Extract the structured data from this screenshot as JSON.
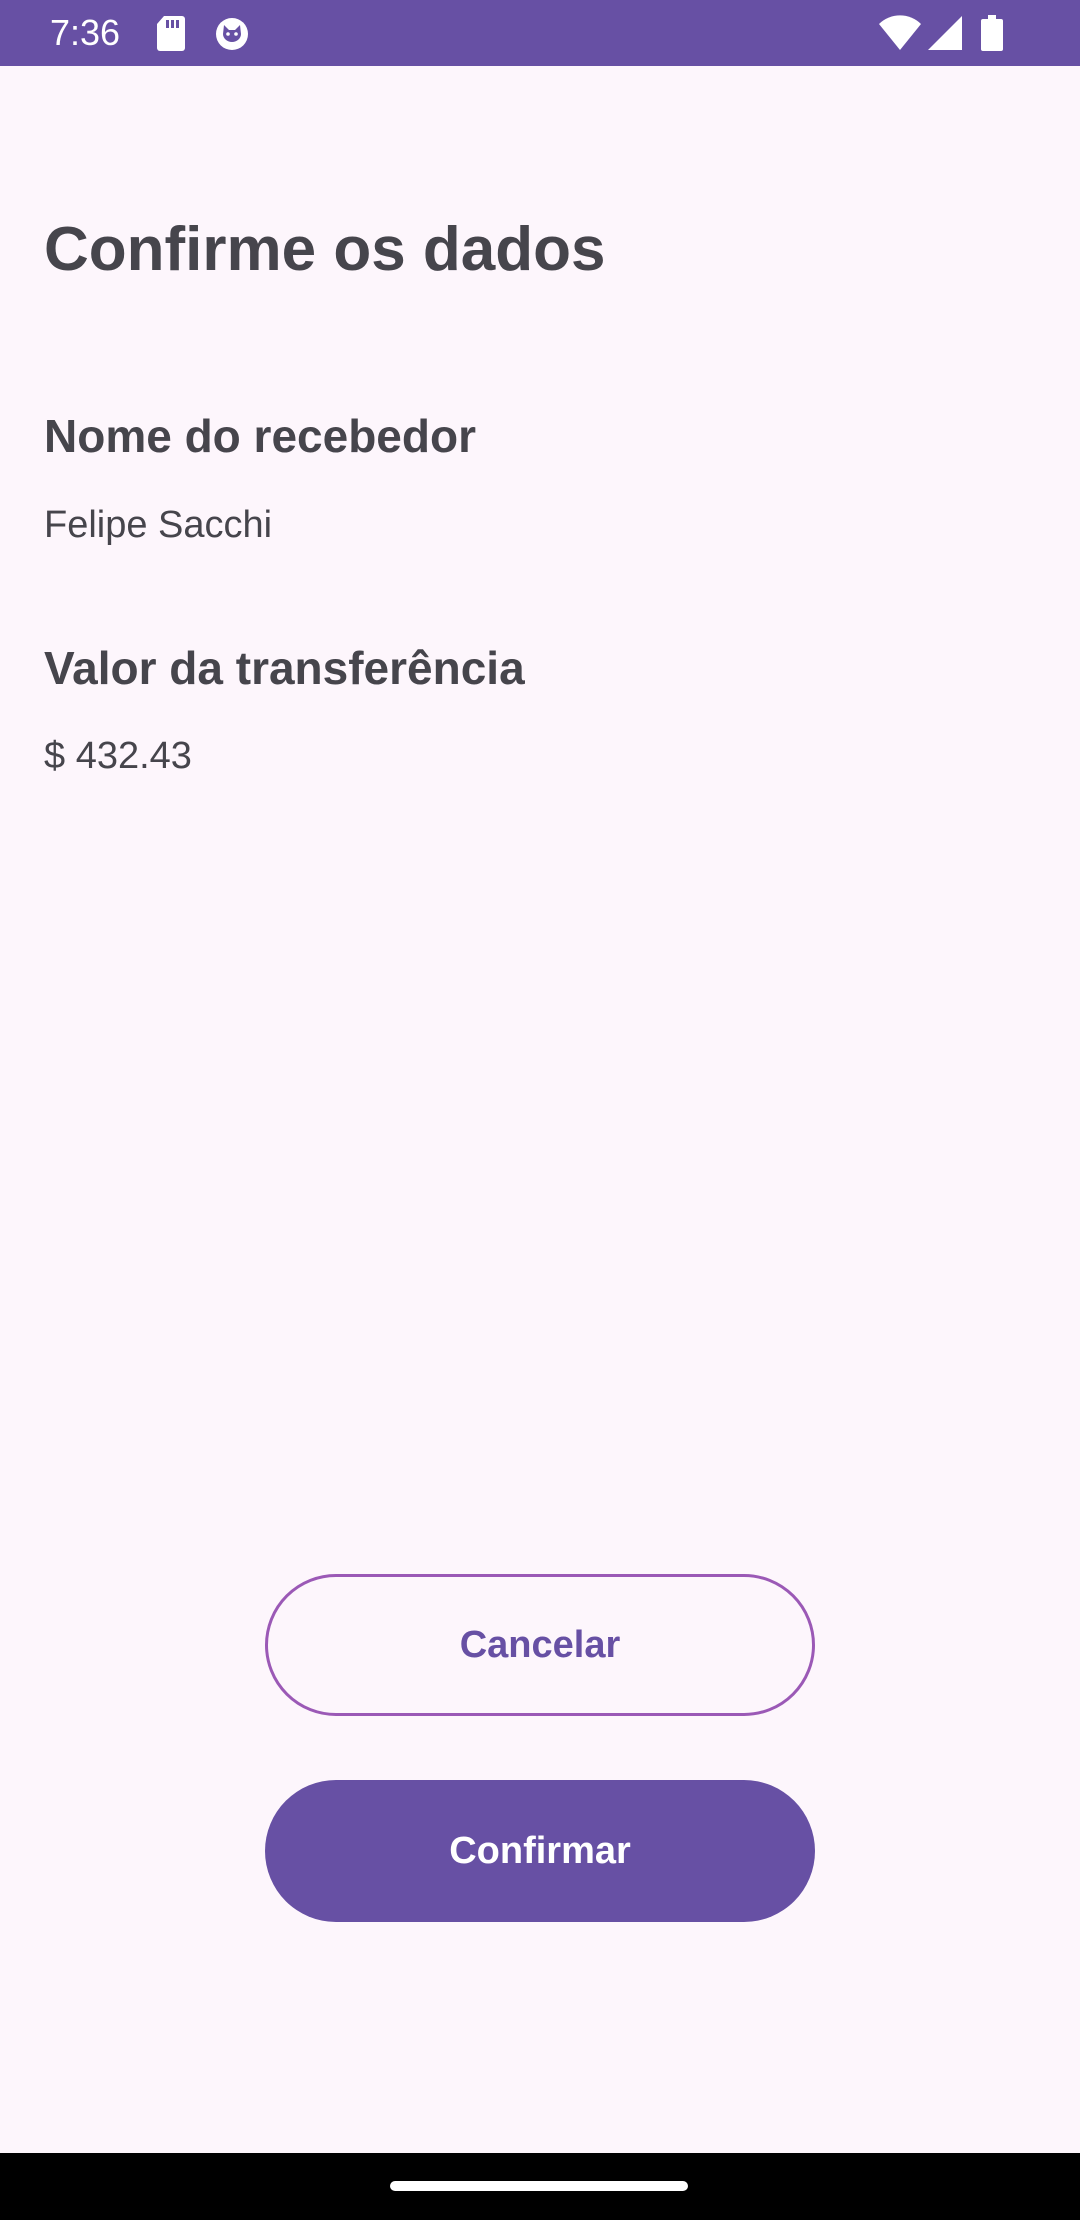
{
  "status_bar": {
    "time": "7:36",
    "background_color": "#6750a4",
    "left_icons": [
      "sd-card-icon",
      "cat-icon"
    ],
    "right_icons": [
      "wifi-icon",
      "signal-icon",
      "battery-icon"
    ]
  },
  "page": {
    "title": "Confirme os dados"
  },
  "fields": {
    "recipient": {
      "label": "Nome do recebedor",
      "value": "Felipe Sacchi"
    },
    "amount": {
      "label": "Valor da transferência",
      "value": "$ 432.43"
    }
  },
  "actions": {
    "cancel_label": "Cancelar",
    "confirm_label": "Confirmar"
  },
  "colors": {
    "accent": "#6750a4",
    "background": "#fdf6fc",
    "text": "#46454c",
    "outline": "#9b59b6"
  }
}
